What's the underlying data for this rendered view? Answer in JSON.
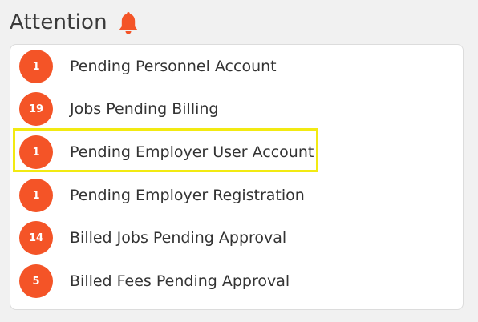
{
  "header": {
    "title": "Attention",
    "icon": "bell-icon",
    "icon_color": "#f45427"
  },
  "attention": {
    "badge_color": "#f45427",
    "items": [
      {
        "count": "1",
        "label": "Pending Personnel Account"
      },
      {
        "count": "19",
        "label": "Jobs Pending Billing"
      },
      {
        "count": "1",
        "label": "Pending Employer User Account"
      },
      {
        "count": "1",
        "label": "Pending Employer Registration"
      },
      {
        "count": "14",
        "label": "Billed Jobs Pending Approval"
      },
      {
        "count": "5",
        "label": "Billed Fees Pending Approval"
      }
    ]
  },
  "highlight": {
    "color": "#f2ea12",
    "target": "Pending Employer User Account"
  }
}
